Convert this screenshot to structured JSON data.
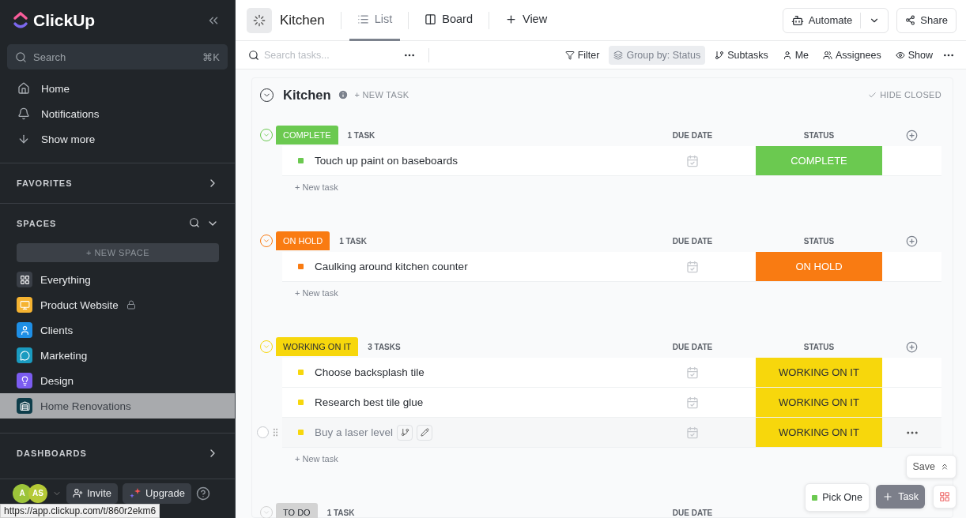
{
  "sidebar": {
    "logo": "ClickUp",
    "search": {
      "placeholder": "Search",
      "shortcut": "⌘K"
    },
    "nav": [
      {
        "label": "Home"
      },
      {
        "label": "Notifications"
      },
      {
        "label": "Show more"
      }
    ],
    "favorites": "FAVORITES",
    "spaces_title": "SPACES",
    "new_space": "+ NEW SPACE",
    "spaces": [
      {
        "label": "Everything",
        "color": "#3a3f47",
        "locked": false,
        "selected": false
      },
      {
        "label": "Product Website",
        "color": "#f5b331",
        "locked": true,
        "selected": false
      },
      {
        "label": "Clients",
        "color": "#1e8fe6",
        "locked": false,
        "selected": false
      },
      {
        "label": "Marketing",
        "color": "#1a9bc0",
        "locked": false,
        "selected": false
      },
      {
        "label": "Design",
        "color": "#7b5cf0",
        "locked": false,
        "selected": false
      },
      {
        "label": "Home Renovations",
        "color": "#0e3d4a",
        "locked": false,
        "selected": true
      }
    ],
    "dashboards": "DASHBOARDS",
    "avatars": [
      "A",
      "AS"
    ],
    "invite": "Invite",
    "upgrade": "Upgrade"
  },
  "status_url": "https://app.clickup.com/t/860r2ekm6",
  "header": {
    "title": "Kitchen",
    "views": [
      {
        "label": "List",
        "selected": true
      },
      {
        "label": "Board",
        "selected": false
      }
    ],
    "add_view": "View",
    "automate": "Automate",
    "share": "Share"
  },
  "toolbar": {
    "search_placeholder": "Search tasks...",
    "items": [
      {
        "label": "Filter",
        "selected": false
      },
      {
        "label": "Group by: Status",
        "selected": true
      },
      {
        "label": "Subtasks",
        "selected": false
      },
      {
        "label": "Me",
        "selected": false
      },
      {
        "label": "Assignees",
        "selected": false
      },
      {
        "label": "Show",
        "selected": false
      }
    ]
  },
  "list": {
    "title": "Kitchen",
    "new_task": "+ NEW TASK",
    "hide_closed": "HIDE CLOSED",
    "groups": [
      {
        "label": "COMPLETE",
        "color": "#6bc950",
        "count": "1 TASK",
        "due_header": "DUE DATE",
        "status_header": "STATUS",
        "add_task": "+ New task",
        "tasks": [
          {
            "name": "Touch up paint on baseboards",
            "status": "COMPLETE",
            "hovered": false
          }
        ]
      },
      {
        "label": "ON HOLD",
        "color": "#f97b12",
        "count": "1 TASK",
        "due_header": "DUE DATE",
        "status_header": "STATUS",
        "add_task": "+ New task",
        "tasks": [
          {
            "name": "Caulking around kitchen counter",
            "status": "ON HOLD",
            "hovered": false
          }
        ]
      },
      {
        "label": "WORKING ON IT",
        "color": "#f7d70c",
        "count": "3 TASKS",
        "due_header": "DUE DATE",
        "status_header": "STATUS",
        "add_task": "+ New task",
        "tasks": [
          {
            "name": "Choose backsplash tile",
            "status": "WORKING ON IT",
            "hovered": false
          },
          {
            "name": "Research best tile glue",
            "status": "WORKING ON IT",
            "hovered": false
          },
          {
            "name": "Buy a laser level",
            "status": "WORKING ON IT",
            "hovered": true
          }
        ]
      },
      {
        "label": "TO DO",
        "color": "#d3d3d3",
        "count": "1 TASK",
        "due_header": "DUE DATE"
      }
    ]
  },
  "floating": {
    "save": "Save",
    "pick": "Pick One",
    "task": "Task"
  }
}
